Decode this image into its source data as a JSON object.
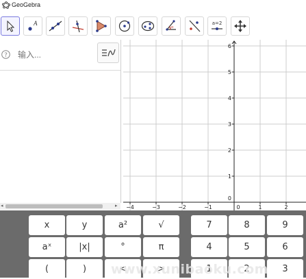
{
  "app": {
    "title": "GeoGebra"
  },
  "toolbar": {
    "tools": [
      {
        "name": "move-tool",
        "icon": "arrow-cursor-icon",
        "selected": true
      },
      {
        "name": "point-tool",
        "icon": "point-a-icon"
      },
      {
        "name": "line-tool",
        "icon": "line-through-points-icon"
      },
      {
        "name": "perpendicular-line-tool",
        "icon": "perpendicular-line-icon"
      },
      {
        "name": "polygon-tool",
        "icon": "polygon-icon"
      },
      {
        "name": "circle-tool",
        "icon": "circle-center-point-icon"
      },
      {
        "name": "ellipse-tool",
        "icon": "ellipse-icon"
      },
      {
        "name": "angle-tool",
        "icon": "angle-icon"
      },
      {
        "name": "reflect-tool",
        "icon": "reflect-about-line-icon"
      },
      {
        "name": "slider-tool",
        "icon": "slider-icon",
        "label": "a=2"
      },
      {
        "name": "move-graphics-view-tool",
        "icon": "move-graphics-view-icon"
      }
    ]
  },
  "algebra": {
    "input_placeholder": "输入...",
    "help_icon": "question-icon",
    "style_button_icon": "algebra-style-icon"
  },
  "graphics": {
    "x_ticks": [
      "−4",
      "−3",
      "−2",
      "−1",
      "0",
      "1",
      "2"
    ],
    "y_ticks": [
      "1",
      "2",
      "3",
      "4",
      "5",
      "6"
    ],
    "y_zero_label": "0",
    "grid": true
  },
  "keyboard": {
    "rows": [
      [
        "x",
        "y",
        "a²",
        "√",
        "7",
        "8",
        "9"
      ],
      [
        "aˣ",
        "|x|",
        "°",
        "π",
        "4",
        "5",
        "6"
      ],
      [
        "(",
        ")",
        "<",
        ">",
        "1",
        "2",
        "3"
      ]
    ]
  },
  "watermark": "www.xunibaoku.com",
  "colors": {
    "toolbar_selected": "#7a7ade",
    "keyboard_bg": "#6b6b6b",
    "axis": "#222222",
    "grid": "#cccccc"
  }
}
